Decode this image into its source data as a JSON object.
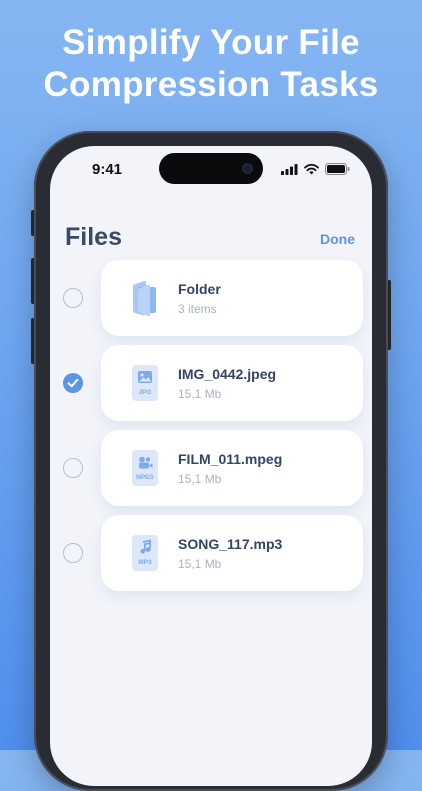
{
  "headline": [
    "Simplify Your File",
    "Compression Tasks"
  ],
  "status_bar": {
    "time": "9:41",
    "icons": [
      "cellular-icon",
      "wifi-icon",
      "battery-icon"
    ]
  },
  "header": {
    "title": "Files",
    "done_label": "Done"
  },
  "colors": {
    "accent": "#5C95E6",
    "title": "#3A4A66",
    "background_gradient": [
      "#86B6F2",
      "#4F8FEE"
    ]
  },
  "files": [
    {
      "name": "Folder",
      "meta": "3 items",
      "type": "folder",
      "selected": false,
      "icon": "folder-icon"
    },
    {
      "name": "IMG_0442.jpeg",
      "meta": "15,1 Mb",
      "type": "JPG",
      "selected": true,
      "icon": "image-file-icon"
    },
    {
      "name": "FILM_011.mpeg",
      "meta": "15,1 Mb",
      "type": "MPEG",
      "selected": false,
      "icon": "video-file-icon"
    },
    {
      "name": "SONG_117.mp3",
      "meta": "15,1 Mb",
      "type": "MP3",
      "selected": false,
      "icon": "audio-file-icon"
    }
  ]
}
